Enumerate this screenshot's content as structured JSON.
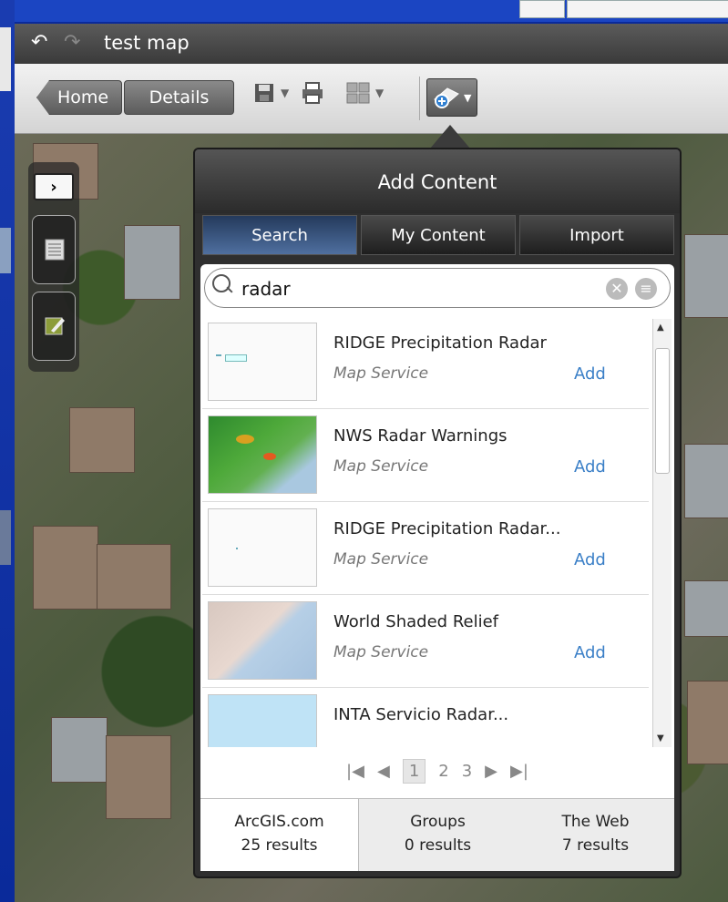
{
  "app": {
    "map_title": "test map"
  },
  "toolbar": {
    "home_label": "Home",
    "details_label": "Details"
  },
  "add_content": {
    "title": "Add Content",
    "tabs": [
      "Search",
      "My Content",
      "Import"
    ],
    "active_tab": "Search",
    "search": {
      "value": "radar",
      "placeholder": ""
    },
    "results": [
      {
        "title": "RIDGE Precipitation Radar",
        "type": "Map Service",
        "action": "Add",
        "thumb": "blank-dots"
      },
      {
        "title": "NWS Radar Warnings",
        "type": "Map Service",
        "action": "Add",
        "thumb": "green-radar"
      },
      {
        "title": "RIDGE Precipitation Radar...",
        "type": "Map Service",
        "action": "Add",
        "thumb": "blank-dot"
      },
      {
        "title": "World Shaded Relief",
        "type": "Map Service",
        "action": "Add",
        "thumb": "relief-map"
      },
      {
        "title": "INTA Servicio Radar...",
        "type": "",
        "action": "",
        "thumb": "light-blue"
      }
    ],
    "pager": {
      "pages": [
        "1",
        "2",
        "3"
      ],
      "current": "1"
    },
    "scopes": [
      {
        "name": "ArcGIS.com",
        "count": "25 results"
      },
      {
        "name": "Groups",
        "count": "0 results"
      },
      {
        "name": "The Web",
        "count": "7 results"
      }
    ]
  },
  "icons": {
    "undo": "undo-icon",
    "redo": "redo-icon",
    "save": "save-icon",
    "print": "print-icon",
    "basemap": "basemap-grid-icon",
    "add": "add-content-icon",
    "search": "search-icon",
    "clear": "clear-icon",
    "menu": "menu-icon"
  },
  "colors": {
    "link_blue": "#3a7fc7",
    "active_tab": "#4f6f9f",
    "panel_dark": "#2f2f2f"
  }
}
